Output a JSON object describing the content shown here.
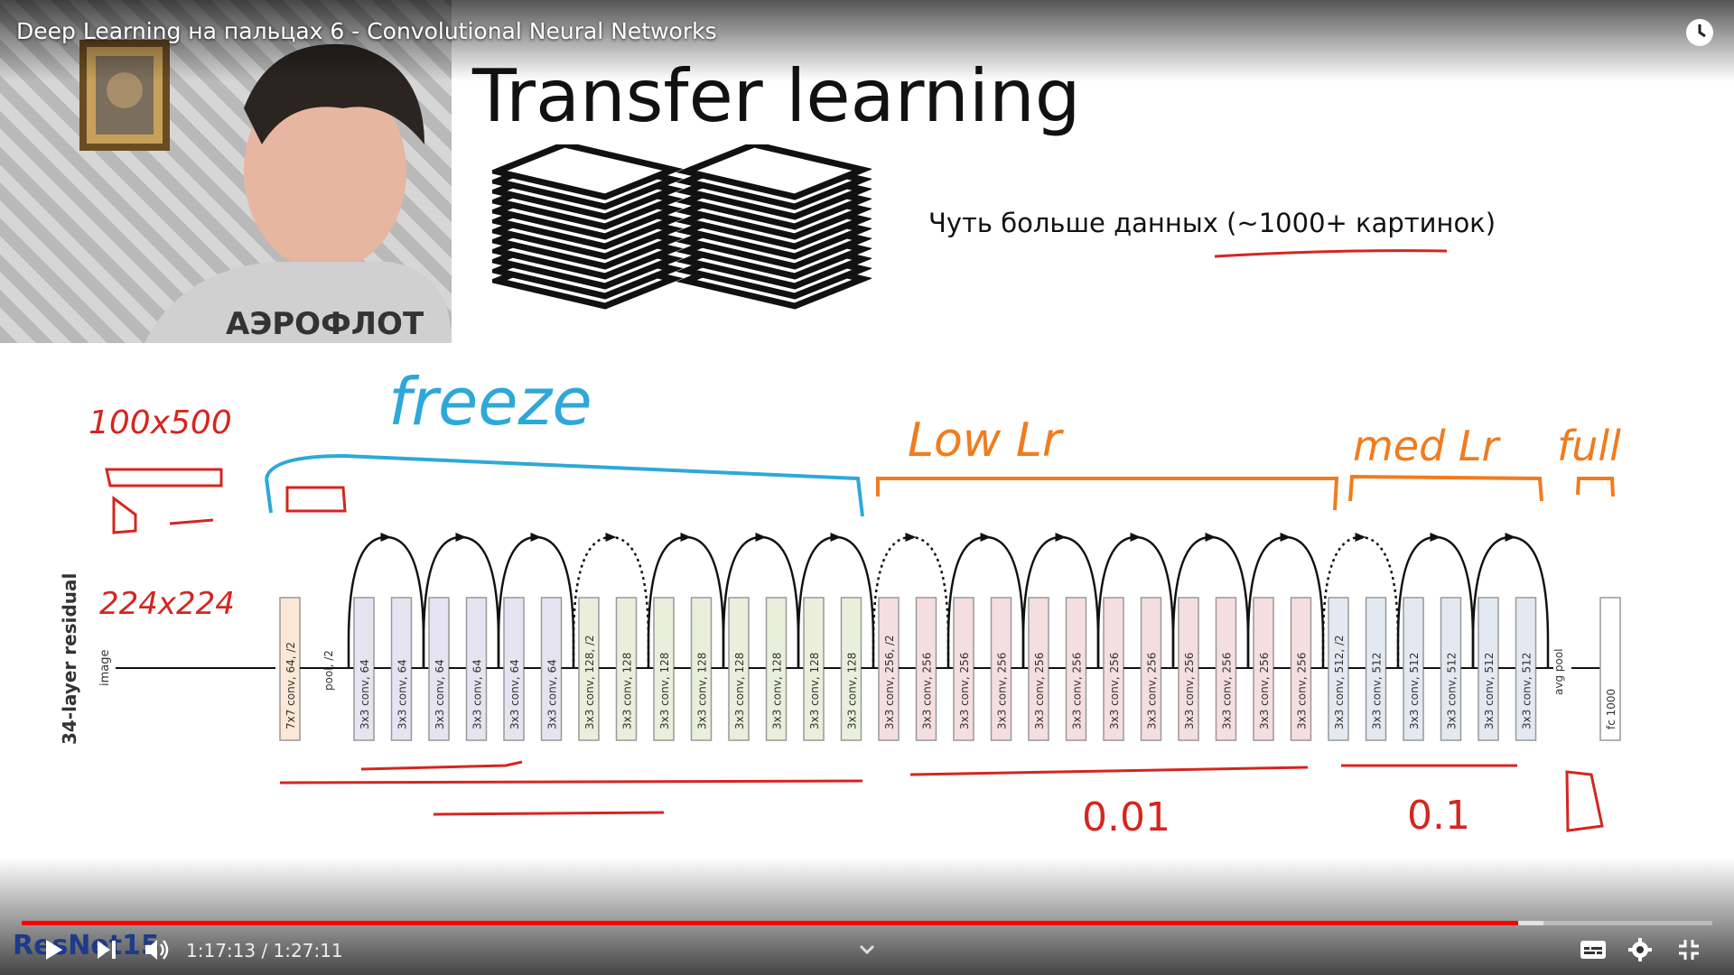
{
  "video": {
    "title": "Deep Learning на пальцах 6 - Convolutional Neural Networks",
    "time_display": "1:17:13 / 1:27:11",
    "progress": 0.885,
    "buffered": 0.9
  },
  "slide": {
    "title": "Transfer learning",
    "caption": "Чуть больше данных (~1000+ картинок)",
    "corner_label": "ResNet15"
  },
  "shirt_text": "АЭРОФЛОТ",
  "handwriting": {
    "freeze": "freeze",
    "low_lr": "Low Lr",
    "med_lr": "med Lr",
    "full": "full",
    "size_small": "100x500",
    "size_input": "224x224",
    "val_001": "0.01",
    "val_01": "0.1"
  },
  "network": {
    "label": "34-layer residual",
    "input": "image",
    "first": "7x7 conv, 64, /2",
    "pool": "pool, /2",
    "avg_pool": "avg pool",
    "fc": "fc 1000",
    "layers": [
      "3x3 conv, 64",
      "3x3 conv, 64",
      "3x3 conv, 64",
      "3x3 conv, 64",
      "3x3 conv, 64",
      "3x3 conv, 64",
      "3x3 conv, 128, /2",
      "3x3 conv, 128",
      "3x3 conv, 128",
      "3x3 conv, 128",
      "3x3 conv, 128",
      "3x3 conv, 128",
      "3x3 conv, 128",
      "3x3 conv, 128",
      "3x3 conv, 256, /2",
      "3x3 conv, 256",
      "3x3 conv, 256",
      "3x3 conv, 256",
      "3x3 conv, 256",
      "3x3 conv, 256",
      "3x3 conv, 256",
      "3x3 conv, 256",
      "3x3 conv, 256",
      "3x3 conv, 256",
      "3x3 conv, 256",
      "3x3 conv, 256",
      "3x3 conv, 512, /2",
      "3x3 conv, 512",
      "3x3 conv, 512",
      "3x3 conv, 512",
      "3x3 conv, 512",
      "3x3 conv, 512"
    ],
    "colors": {
      "conv64": "#e6e4f0",
      "conv128": "#e9efda",
      "conv256": "#f5dedf",
      "conv512": "#e2e9f1",
      "first": "#fbe8d6",
      "fc": "#ffffff"
    }
  },
  "colors": {
    "freeze": "#2ea8d8",
    "low": "#f07c1e",
    "red": "#d4261f",
    "accent": "#ff0000"
  },
  "icons": {
    "play": "play-icon",
    "next": "next-icon",
    "volume": "volume-icon",
    "subtitles": "subtitles-icon",
    "settings": "gear-icon",
    "exit_fullscreen": "exit-fullscreen-icon",
    "watch_later": "clock-icon",
    "chevron": "chevron-down-icon"
  }
}
